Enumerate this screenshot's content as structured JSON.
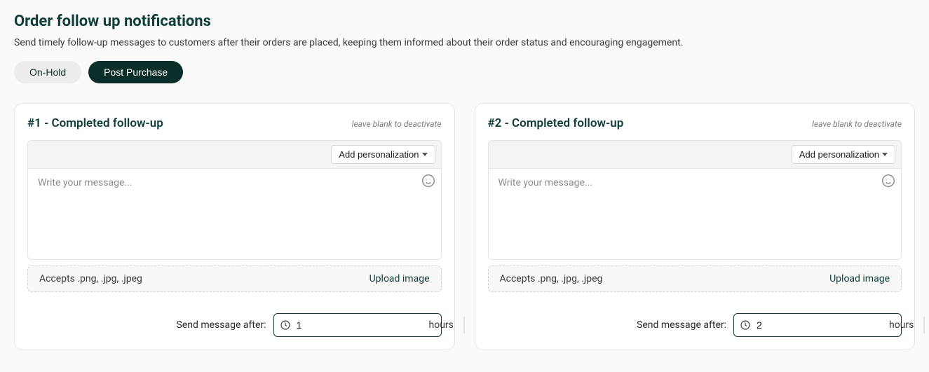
{
  "page": {
    "title": "Order follow up notifications",
    "subtitle": "Send timely follow-up messages to customers after their orders are placed, keeping them informed about their order status and encouraging engagement."
  },
  "tabs": {
    "on_hold": "On-Hold",
    "post_purchase": "Post Purchase"
  },
  "common": {
    "deactivate_hint": "leave blank to deactivate",
    "personalization_label": "Add personalization",
    "message_placeholder": "Write your message...",
    "accepts_text": "Accepts .png, .jpg, .jpeg",
    "upload_label": "Upload image",
    "send_after_label": "Send message after:",
    "unit_label": "hours"
  },
  "cards": [
    {
      "title": "#1 - Completed follow-up",
      "delay_value": "1"
    },
    {
      "title": "#2 - Completed follow-up",
      "delay_value": "2"
    }
  ]
}
